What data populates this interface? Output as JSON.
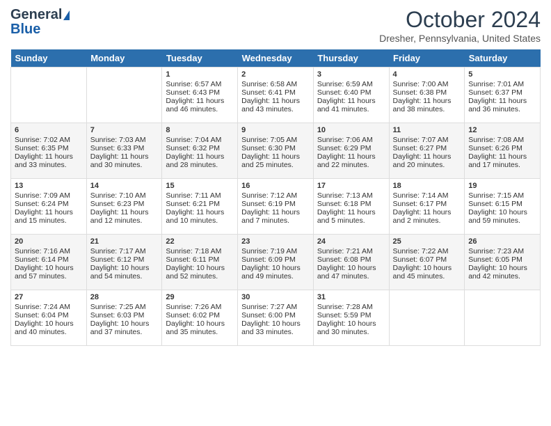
{
  "header": {
    "logo_line1": "General",
    "logo_line2": "Blue",
    "month": "October 2024",
    "location": "Dresher, Pennsylvania, United States"
  },
  "weekdays": [
    "Sunday",
    "Monday",
    "Tuesday",
    "Wednesday",
    "Thursday",
    "Friday",
    "Saturday"
  ],
  "weeks": [
    [
      {
        "day": "",
        "sunrise": "",
        "sunset": "",
        "daylight": ""
      },
      {
        "day": "",
        "sunrise": "",
        "sunset": "",
        "daylight": ""
      },
      {
        "day": "1",
        "sunrise": "Sunrise: 6:57 AM",
        "sunset": "Sunset: 6:43 PM",
        "daylight": "Daylight: 11 hours and 46 minutes."
      },
      {
        "day": "2",
        "sunrise": "Sunrise: 6:58 AM",
        "sunset": "Sunset: 6:41 PM",
        "daylight": "Daylight: 11 hours and 43 minutes."
      },
      {
        "day": "3",
        "sunrise": "Sunrise: 6:59 AM",
        "sunset": "Sunset: 6:40 PM",
        "daylight": "Daylight: 11 hours and 41 minutes."
      },
      {
        "day": "4",
        "sunrise": "Sunrise: 7:00 AM",
        "sunset": "Sunset: 6:38 PM",
        "daylight": "Daylight: 11 hours and 38 minutes."
      },
      {
        "day": "5",
        "sunrise": "Sunrise: 7:01 AM",
        "sunset": "Sunset: 6:37 PM",
        "daylight": "Daylight: 11 hours and 36 minutes."
      }
    ],
    [
      {
        "day": "6",
        "sunrise": "Sunrise: 7:02 AM",
        "sunset": "Sunset: 6:35 PM",
        "daylight": "Daylight: 11 hours and 33 minutes."
      },
      {
        "day": "7",
        "sunrise": "Sunrise: 7:03 AM",
        "sunset": "Sunset: 6:33 PM",
        "daylight": "Daylight: 11 hours and 30 minutes."
      },
      {
        "day": "8",
        "sunrise": "Sunrise: 7:04 AM",
        "sunset": "Sunset: 6:32 PM",
        "daylight": "Daylight: 11 hours and 28 minutes."
      },
      {
        "day": "9",
        "sunrise": "Sunrise: 7:05 AM",
        "sunset": "Sunset: 6:30 PM",
        "daylight": "Daylight: 11 hours and 25 minutes."
      },
      {
        "day": "10",
        "sunrise": "Sunrise: 7:06 AM",
        "sunset": "Sunset: 6:29 PM",
        "daylight": "Daylight: 11 hours and 22 minutes."
      },
      {
        "day": "11",
        "sunrise": "Sunrise: 7:07 AM",
        "sunset": "Sunset: 6:27 PM",
        "daylight": "Daylight: 11 hours and 20 minutes."
      },
      {
        "day": "12",
        "sunrise": "Sunrise: 7:08 AM",
        "sunset": "Sunset: 6:26 PM",
        "daylight": "Daylight: 11 hours and 17 minutes."
      }
    ],
    [
      {
        "day": "13",
        "sunrise": "Sunrise: 7:09 AM",
        "sunset": "Sunset: 6:24 PM",
        "daylight": "Daylight: 11 hours and 15 minutes."
      },
      {
        "day": "14",
        "sunrise": "Sunrise: 7:10 AM",
        "sunset": "Sunset: 6:23 PM",
        "daylight": "Daylight: 11 hours and 12 minutes."
      },
      {
        "day": "15",
        "sunrise": "Sunrise: 7:11 AM",
        "sunset": "Sunset: 6:21 PM",
        "daylight": "Daylight: 11 hours and 10 minutes."
      },
      {
        "day": "16",
        "sunrise": "Sunrise: 7:12 AM",
        "sunset": "Sunset: 6:19 PM",
        "daylight": "Daylight: 11 hours and 7 minutes."
      },
      {
        "day": "17",
        "sunrise": "Sunrise: 7:13 AM",
        "sunset": "Sunset: 6:18 PM",
        "daylight": "Daylight: 11 hours and 5 minutes."
      },
      {
        "day": "18",
        "sunrise": "Sunrise: 7:14 AM",
        "sunset": "Sunset: 6:17 PM",
        "daylight": "Daylight: 11 hours and 2 minutes."
      },
      {
        "day": "19",
        "sunrise": "Sunrise: 7:15 AM",
        "sunset": "Sunset: 6:15 PM",
        "daylight": "Daylight: 10 hours and 59 minutes."
      }
    ],
    [
      {
        "day": "20",
        "sunrise": "Sunrise: 7:16 AM",
        "sunset": "Sunset: 6:14 PM",
        "daylight": "Daylight: 10 hours and 57 minutes."
      },
      {
        "day": "21",
        "sunrise": "Sunrise: 7:17 AM",
        "sunset": "Sunset: 6:12 PM",
        "daylight": "Daylight: 10 hours and 54 minutes."
      },
      {
        "day": "22",
        "sunrise": "Sunrise: 7:18 AM",
        "sunset": "Sunset: 6:11 PM",
        "daylight": "Daylight: 10 hours and 52 minutes."
      },
      {
        "day": "23",
        "sunrise": "Sunrise: 7:19 AM",
        "sunset": "Sunset: 6:09 PM",
        "daylight": "Daylight: 10 hours and 49 minutes."
      },
      {
        "day": "24",
        "sunrise": "Sunrise: 7:21 AM",
        "sunset": "Sunset: 6:08 PM",
        "daylight": "Daylight: 10 hours and 47 minutes."
      },
      {
        "day": "25",
        "sunrise": "Sunrise: 7:22 AM",
        "sunset": "Sunset: 6:07 PM",
        "daylight": "Daylight: 10 hours and 45 minutes."
      },
      {
        "day": "26",
        "sunrise": "Sunrise: 7:23 AM",
        "sunset": "Sunset: 6:05 PM",
        "daylight": "Daylight: 10 hours and 42 minutes."
      }
    ],
    [
      {
        "day": "27",
        "sunrise": "Sunrise: 7:24 AM",
        "sunset": "Sunset: 6:04 PM",
        "daylight": "Daylight: 10 hours and 40 minutes."
      },
      {
        "day": "28",
        "sunrise": "Sunrise: 7:25 AM",
        "sunset": "Sunset: 6:03 PM",
        "daylight": "Daylight: 10 hours and 37 minutes."
      },
      {
        "day": "29",
        "sunrise": "Sunrise: 7:26 AM",
        "sunset": "Sunset: 6:02 PM",
        "daylight": "Daylight: 10 hours and 35 minutes."
      },
      {
        "day": "30",
        "sunrise": "Sunrise: 7:27 AM",
        "sunset": "Sunset: 6:00 PM",
        "daylight": "Daylight: 10 hours and 33 minutes."
      },
      {
        "day": "31",
        "sunrise": "Sunrise: 7:28 AM",
        "sunset": "Sunset: 5:59 PM",
        "daylight": "Daylight: 10 hours and 30 minutes."
      },
      {
        "day": "",
        "sunrise": "",
        "sunset": "",
        "daylight": ""
      },
      {
        "day": "",
        "sunrise": "",
        "sunset": "",
        "daylight": ""
      }
    ]
  ]
}
